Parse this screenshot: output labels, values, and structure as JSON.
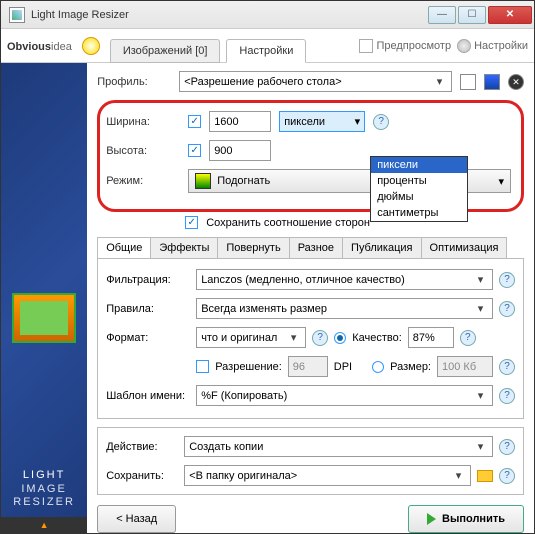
{
  "window": {
    "title": "Light Image Resizer"
  },
  "brand": {
    "obvious": "Obvious",
    "idea": "idea"
  },
  "topTabs": {
    "images": "Изображений [0]",
    "settings": "Настройки"
  },
  "topRight": {
    "preview": "Предпросмотр",
    "settings": "Настройки"
  },
  "profile": {
    "label": "Профиль:",
    "value": "<Разрешение рабочего стола>"
  },
  "dims": {
    "widthLabel": "Ширина:",
    "widthValue": "1600",
    "heightLabel": "Высота:",
    "heightValue": "900",
    "unitSelected": "пиксели",
    "unitOptions": [
      "пиксели",
      "проценты",
      "дюймы",
      "сантиметры"
    ],
    "modeLabel": "Режим:",
    "modeValue": "Подогнать",
    "keepRatio": "Сохранить соотношение сторон"
  },
  "subTabs": [
    "Общие",
    "Эффекты",
    "Повернуть",
    "Разное",
    "Публикация",
    "Оптимизация"
  ],
  "general": {
    "filterLabel": "Фильтрация:",
    "filterValue": "Lanczos (медленно, отличное качество)",
    "rulesLabel": "Правила:",
    "rulesValue": "Всегда изменять размер",
    "formatLabel": "Формат:",
    "formatValue": "что и оригинал",
    "qualityLabel": "Качество:",
    "qualityValue": "87%",
    "sizeLabel": "Размер:",
    "sizeValue": "100 Кб",
    "resolutionLabel": "Разрешение:",
    "resolutionValue": "96",
    "dpi": "DPI",
    "nameTplLabel": "Шаблон имени:",
    "nameTplValue": "%F (Копировать)"
  },
  "bottom": {
    "actionLabel": "Действие:",
    "actionValue": "Создать копии",
    "saveLabel": "Сохранить:",
    "saveValue": "<В папку оригинала>"
  },
  "buttons": {
    "back": "< Назад",
    "run": "Выполнить"
  },
  "sidebarText": {
    "l1": "LIGHT",
    "l2": "IMAGE",
    "l3": "RESIZER"
  }
}
